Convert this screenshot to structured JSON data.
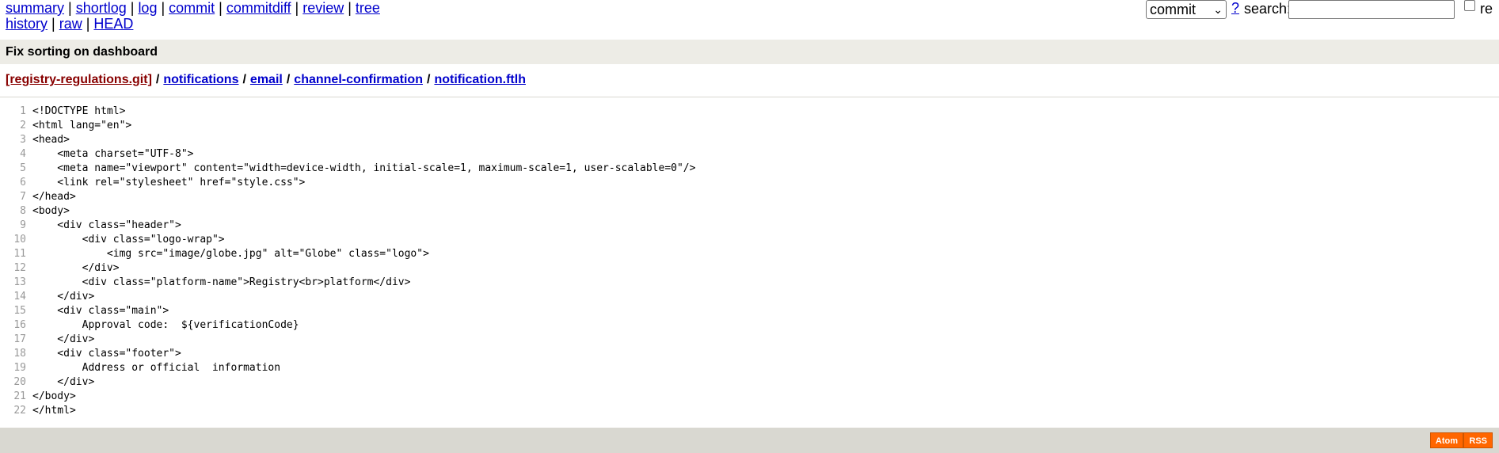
{
  "nav": {
    "row1": [
      "summary",
      "shortlog",
      "log",
      "commit",
      "commitdiff",
      "review",
      "tree"
    ],
    "row2": [
      "history",
      "raw",
      "HEAD"
    ]
  },
  "search": {
    "type_value": "commit",
    "help": "?",
    "label": "search:",
    "input_value": "",
    "regex_label": "re"
  },
  "title": "Fix sorting on dashboard",
  "path": {
    "repo": "[registry-regulations.git]",
    "segments": [
      "notifications",
      "email",
      "channel-confirmation",
      "notification.ftlh"
    ]
  },
  "code": [
    {
      "n": "1",
      "text": "<!DOCTYPE html>"
    },
    {
      "n": "2",
      "text": "<html lang=\"en\">"
    },
    {
      "n": "3",
      "text": "<head>"
    },
    {
      "n": "4",
      "text": "    <meta charset=\"UTF-8\">"
    },
    {
      "n": "5",
      "text": "    <meta name=\"viewport\" content=\"width=device-width, initial-scale=1, maximum-scale=1, user-scalable=0\"/>"
    },
    {
      "n": "6",
      "text": "    <link rel=\"stylesheet\" href=\"style.css\">"
    },
    {
      "n": "7",
      "text": "</head>"
    },
    {
      "n": "8",
      "text": "<body>"
    },
    {
      "n": "9",
      "text": "    <div class=\"header\">"
    },
    {
      "n": "10",
      "text": "        <div class=\"logo-wrap\">"
    },
    {
      "n": "11",
      "text": "            <img src=\"image/globe.jpg\" alt=\"Globe\" class=\"logo\">"
    },
    {
      "n": "12",
      "text": "        </div>"
    },
    {
      "n": "13",
      "text": "        <div class=\"platform-name\">Registry<br>platform</div>"
    },
    {
      "n": "14",
      "text": "    </div>"
    },
    {
      "n": "15",
      "text": "    <div class=\"main\">"
    },
    {
      "n": "16",
      "text": "        Approval code:  ${verificationCode}"
    },
    {
      "n": "17",
      "text": "    </div>"
    },
    {
      "n": "18",
      "text": "    <div class=\"footer\">"
    },
    {
      "n": "19",
      "text": "        Address or official  information"
    },
    {
      "n": "20",
      "text": "    </div>"
    },
    {
      "n": "21",
      "text": "</body>"
    },
    {
      "n": "22",
      "text": "</html>"
    }
  ],
  "footer": {
    "atom": "Atom",
    "rss": "RSS",
    "feed_color": "#ff6600"
  }
}
